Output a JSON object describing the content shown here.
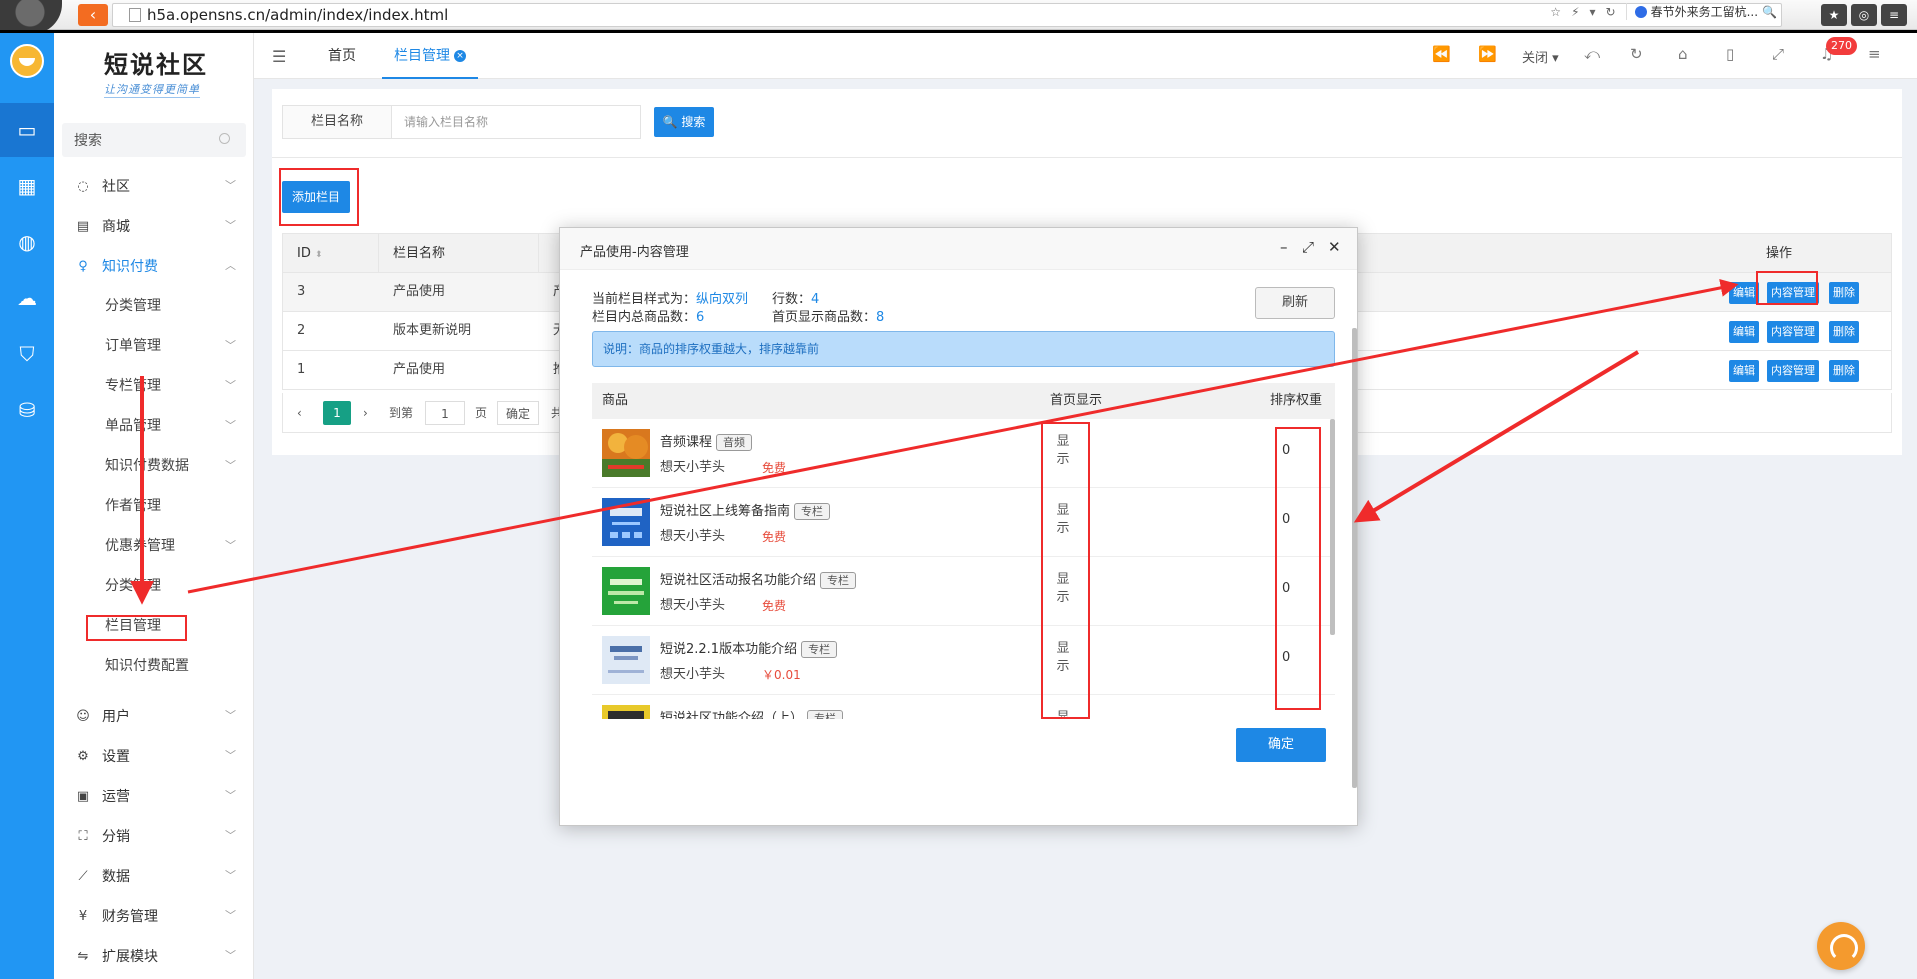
{
  "browser": {
    "url": "h5a.opensns.cn/admin/index/index.html",
    "search_engine_text": "春节外来务工留杭..."
  },
  "brand": {
    "name": "短说社区",
    "slogan": "让沟通变得更简单"
  },
  "sidebar": {
    "search_placeholder": "搜索",
    "menu": [
      {
        "label": "社区",
        "icon": "community-icon"
      },
      {
        "label": "商城",
        "icon": "shop-icon"
      },
      {
        "label": "知识付费",
        "icon": "lightbulb-icon",
        "active": true
      },
      {
        "label": "用户",
        "icon": "user-icon"
      },
      {
        "label": "设置",
        "icon": "gear-icon"
      },
      {
        "label": "运营",
        "icon": "operation-icon"
      },
      {
        "label": "分销",
        "icon": "distribution-icon"
      },
      {
        "label": "数据",
        "icon": "chart-icon"
      },
      {
        "label": "财务管理",
        "icon": "finance-icon"
      },
      {
        "label": "扩展模块",
        "icon": "extension-icon"
      }
    ],
    "submenu": [
      "分类管理",
      "订单管理",
      "专栏管理",
      "单品管理",
      "知识付费数据",
      "作者管理",
      "优惠券管理",
      "分类管理",
      "栏目管理",
      "知识付费配置"
    ]
  },
  "topnav": {
    "tabs": [
      "首页",
      "栏目管理"
    ],
    "close_label": "关闭",
    "badge": "270"
  },
  "filter": {
    "label": "栏目名称",
    "placeholder": "请输入栏目名称",
    "search_label": "搜索"
  },
  "add_button": "添加栏目",
  "table": {
    "headers": [
      "ID",
      "栏目名称",
      "操作"
    ],
    "rows": [
      {
        "id": "3",
        "name": "产品使用",
        "extra": "产"
      },
      {
        "id": "2",
        "name": "版本更新说明",
        "extra": "无"
      },
      {
        "id": "1",
        "name": "产品使用",
        "extra": "推"
      }
    ],
    "actions": [
      "编辑",
      "内容管理",
      "删除"
    ]
  },
  "pager": {
    "current": "1",
    "goto_label": "到第",
    "page_value": "1",
    "page_unit": "页",
    "confirm": "确定",
    "total_prefix": "共"
  },
  "modal": {
    "title": "产品使用-内容管理",
    "style_label": "当前栏目样式为：",
    "style_value": "纵向双列",
    "rows_label": "行数：",
    "rows_value": "4",
    "total_label": "栏目内总商品数：",
    "total_value": "6",
    "home_label": "首页显示商品数：",
    "home_value": "8",
    "refresh": "刷新",
    "notice": "说明：商品的排序权重越大，排序越靠前",
    "cols": [
      "商品",
      "首页显示",
      "排序权重"
    ],
    "items": [
      {
        "name": "音频课程",
        "tag": "音频",
        "author": "想天小芋头",
        "price": "免费",
        "show": "显示",
        "weight": "0"
      },
      {
        "name": "短说社区上线筹备指南",
        "tag": "专栏",
        "author": "想天小芋头",
        "price": "免费",
        "show": "显示",
        "weight": "0"
      },
      {
        "name": "短说社区活动报名功能介绍",
        "tag": "专栏",
        "author": "想天小芋头",
        "price": "免费",
        "show": "显示",
        "weight": "0"
      },
      {
        "name": "短说2.2.1版本功能介绍",
        "tag": "专栏",
        "author": "想天小芋头",
        "price": "￥0.01",
        "show": "显示",
        "weight": "0"
      },
      {
        "name": "短说社区功能介绍（上）",
        "tag": "专栏",
        "author": "",
        "price": "",
        "show": "显",
        "weight": ""
      }
    ],
    "ok": "确定"
  },
  "colors": {
    "primary": "#1e88e5",
    "rail": "#2196f3",
    "annotation": "#ef2b2b",
    "price": "#e74c3c"
  }
}
